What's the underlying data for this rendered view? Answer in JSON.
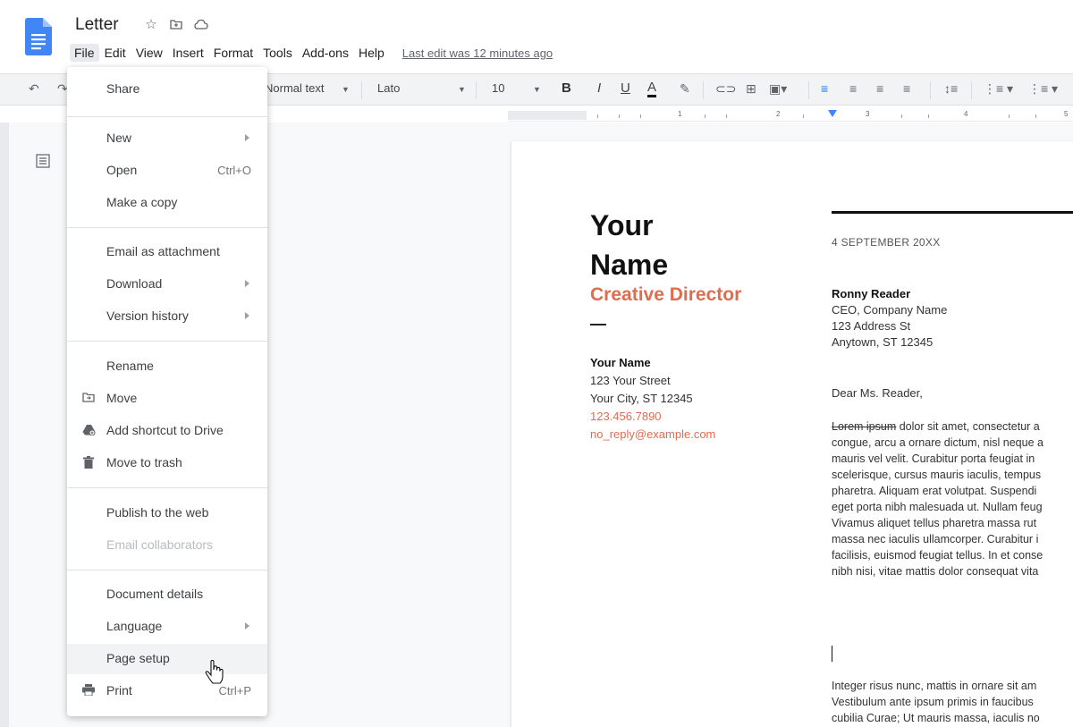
{
  "doc": {
    "title": "Letter",
    "icons": [
      "star-icon",
      "folder-icon",
      "cloud-icon"
    ]
  },
  "menubar": {
    "items": [
      "File",
      "Edit",
      "View",
      "Insert",
      "Format",
      "Tools",
      "Add-ons",
      "Help"
    ],
    "last_edit": "Last edit was 12 minutes ago"
  },
  "toolbar": {
    "style": "Normal text",
    "font": "Lato",
    "size": "10",
    "bold": "B",
    "italic": "I",
    "underline": "U",
    "text_color": "A"
  },
  "ruler": {
    "numbers": [
      "1",
      "1",
      "2",
      "3",
      "4",
      "5"
    ]
  },
  "file_menu": {
    "items": [
      {
        "label": "Share"
      },
      {
        "label": "New",
        "submenu": true
      },
      {
        "label": "Open",
        "shortcut": "Ctrl+O"
      },
      {
        "label": "Make a copy"
      },
      {
        "label": "Email as attachment"
      },
      {
        "label": "Download",
        "submenu": true
      },
      {
        "label": "Version history",
        "submenu": true
      },
      {
        "label": "Rename"
      },
      {
        "label": "Move",
        "icon": "move-folder-icon"
      },
      {
        "label": "Add shortcut to Drive",
        "icon": "drive-shortcut-icon"
      },
      {
        "label": "Move to trash",
        "icon": "trash-icon"
      },
      {
        "label": "Publish to the web"
      },
      {
        "label": "Email collaborators",
        "disabled": true
      },
      {
        "label": "Document details"
      },
      {
        "label": "Language",
        "submenu": true
      },
      {
        "label": "Page setup",
        "hovered": true
      },
      {
        "label": "Print",
        "shortcut": "Ctrl+P",
        "icon": "printer-icon"
      }
    ]
  },
  "letter": {
    "name_line1": "Your",
    "name_line2": "Name",
    "role": "Creative Director",
    "contact_name": "Your Name",
    "street": "123 Your Street",
    "city": "Your City, ST 12345",
    "phone": "123.456.7890",
    "email": "no_reply@example.com",
    "date": "4 SEPTEMBER 20XX",
    "recipient_name": "Ronny Reader",
    "recipient_title": "CEO, Company Name",
    "recipient_street": "123 Address St",
    "recipient_city": "Anytown, ST 12345",
    "greeting": "Dear Ms. Reader,",
    "para1_strike": "Lorem ipsum",
    "para1_rest": " dolor sit amet, consectetur a",
    "para1_lines": [
      "congue, arcu a ornare dictum, nisl neque a",
      "mauris vel velit. Curabitur porta feugiat in",
      "scelerisque, cursus mauris iaculis, tempus",
      "pharetra. Aliquam erat volutpat. Suspendi",
      "eget porta nibh malesuada ut. Nullam feug",
      "Vivamus aliquet tellus pharetra massa rut",
      "massa nec iaculis ullamcorper. Curabitur i",
      "facilisis, euismod feugiat tellus. In et conse",
      "nibh nisi, vitae mattis dolor consequat vita"
    ],
    "para2_lines": [
      "Integer risus nunc, mattis in ornare sit am",
      "Vestibulum ante ipsum primis in faucibus",
      "cubilia Curae; Ut mauris massa, iaculis no"
    ]
  },
  "colors": {
    "accent": "#e06c4e",
    "docs_blue": "#4285f4",
    "toolbar_bg": "#f1f3f4"
  }
}
